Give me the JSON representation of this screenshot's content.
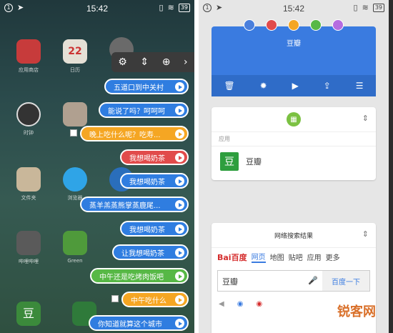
{
  "status_left": {
    "time": "15:42",
    "battery": "39"
  },
  "status_right": {
    "time": "15:42",
    "battery": "39"
  },
  "home_apps": [
    {
      "label": "应用商店",
      "color": "#c73b3b"
    },
    {
      "label": "日历",
      "color": "#e5e0d6"
    },
    {
      "label": "",
      "color": "#8a8a8a"
    },
    {
      "label": "时钟",
      "color": "#333333"
    },
    {
      "label": "",
      "color": "#b0a090"
    },
    {
      "label": "文件夹",
      "color": "#c9b79a"
    },
    {
      "label": "浏览器",
      "color": "#2fa4e7"
    },
    {
      "label": "",
      "color": "#2a6ebb"
    },
    {
      "label": "哔哩哔哩",
      "color": "#5a5a5a"
    },
    {
      "label": "Green",
      "color": "#4f9a3b"
    },
    {
      "label": "豆瓣",
      "color": "#3b8a3b"
    },
    {
      "label": "",
      "color": "#2f7a3a"
    }
  ],
  "calendar_day": "22",
  "quick_bar": {
    "gear": "⚙",
    "sort": "⇕",
    "add": "⊕",
    "next": "›"
  },
  "clipboard_items": [
    {
      "text": "五道口到中关村",
      "color": "blue"
    },
    {
      "text": "能说了吗？呵呵呵",
      "color": "blue"
    },
    {
      "text": "晚上吃什么呢？吃寿...",
      "color": "orange"
    },
    {
      "text": "我想喝奶茶",
      "color": "red"
    },
    {
      "text": "我想喝奶茶",
      "color": "blue"
    },
    {
      "text": "蒸羊羔蒸熊掌蒸鹿尾...",
      "color": "blue"
    },
    {
      "text": "我想喝奶茶",
      "color": "blue"
    },
    {
      "text": "让我想喝奶茶",
      "color": "blue"
    },
    {
      "text": "中午还是吃烤肉饭吧",
      "color": "green"
    },
    {
      "text": "中午吃什么",
      "color": "orange"
    },
    {
      "text": "你知道就算这个城市",
      "color": "blue"
    }
  ],
  "widget_top": {
    "title": "豆瓣",
    "tab_colors": [
      "#4a7fdc",
      "#e14b4b",
      "#f5a623",
      "#57b846",
      "#b66de0"
    ],
    "actions": [
      "delete",
      "settings",
      "play",
      "share",
      "list"
    ]
  },
  "app_card": {
    "section": "应用",
    "app_name": "豆瓣",
    "app_icon_char": "豆"
  },
  "search_card": {
    "title": "网络搜索结果",
    "tabs": [
      "网页",
      "地图",
      "贴吧",
      "应用",
      "更多"
    ],
    "query": "豆瓣",
    "button": "百度一下",
    "logo": "Bai百度"
  },
  "watermark": "锐客网"
}
